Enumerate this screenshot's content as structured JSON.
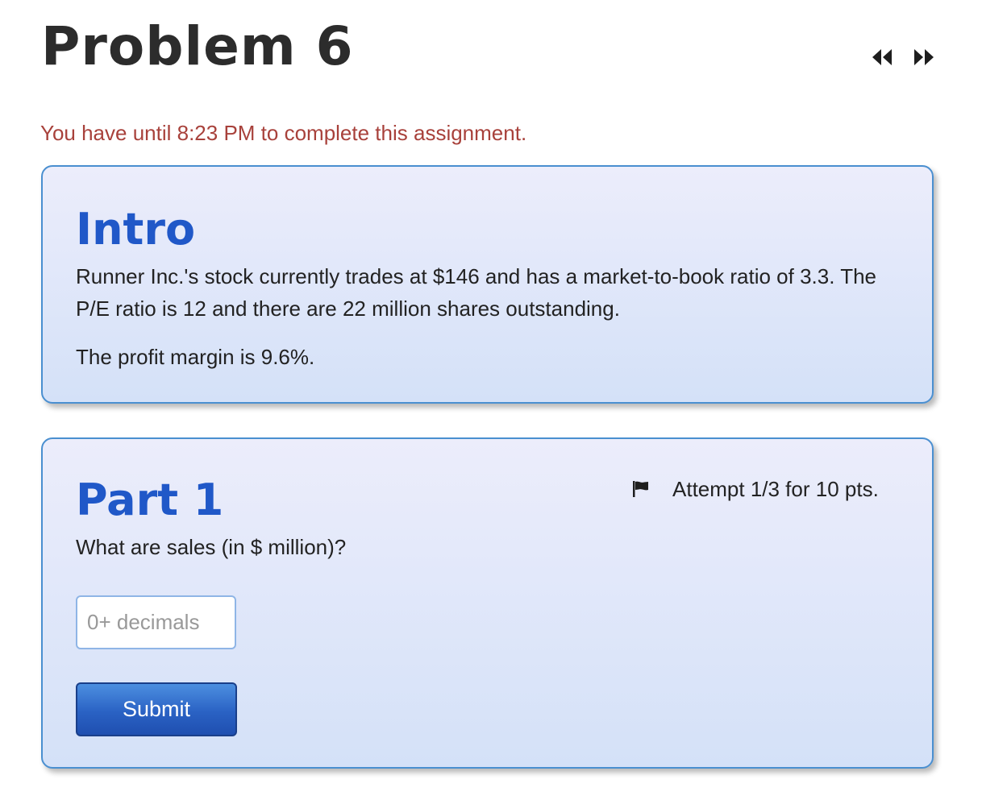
{
  "header": {
    "title": "Problem 6",
    "nav": {
      "previous_icon": "double-chevron-left-icon",
      "next_icon": "double-chevron-right-icon"
    }
  },
  "deadline_notice": "You have until 8:23 PM to complete this assignment.",
  "intro": {
    "heading": "Intro",
    "paragraphs": [
      "Runner Inc.'s stock currently trades at $146 and has a market-to-book ratio of 3.3. The P/E ratio is 12 and there are 22 million shares outstanding.",
      "The profit margin is 9.6%."
    ]
  },
  "part1": {
    "heading": "Part 1",
    "flag_icon": "flag-icon",
    "attempt_text": "Attempt 1/3 for 10 pts.",
    "question": "What are sales (in $ million)?",
    "answer": {
      "value": "",
      "placeholder": "0+ decimals"
    },
    "submit_label": "Submit"
  },
  "colors": {
    "heading_blue": "#2058c8",
    "deadline_red": "#a8413b",
    "card_border": "#4a8fd0",
    "button_blue": "#2a62c4"
  }
}
